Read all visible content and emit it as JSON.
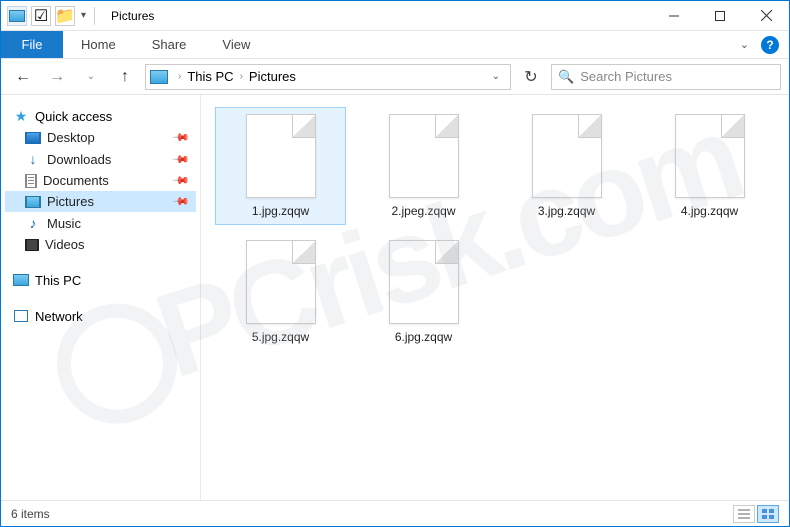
{
  "window": {
    "title": "Pictures"
  },
  "ribbon": {
    "file": "File",
    "tabs": [
      "Home",
      "Share",
      "View"
    ]
  },
  "breadcrumb": {
    "items": [
      "This PC",
      "Pictures"
    ]
  },
  "search": {
    "placeholder": "Search Pictures"
  },
  "sidebar": {
    "quick_access": {
      "label": "Quick access",
      "items": [
        {
          "label": "Desktop",
          "icon": "desktop",
          "pinned": true
        },
        {
          "label": "Downloads",
          "icon": "downloads",
          "pinned": true
        },
        {
          "label": "Documents",
          "icon": "doc",
          "pinned": true
        },
        {
          "label": "Pictures",
          "icon": "pic",
          "pinned": true,
          "selected": true
        },
        {
          "label": "Music",
          "icon": "music",
          "pinned": false
        },
        {
          "label": "Videos",
          "icon": "video",
          "pinned": false
        }
      ]
    },
    "this_pc": {
      "label": "This PC"
    },
    "network": {
      "label": "Network"
    }
  },
  "files": [
    {
      "name": "1.jpg.zqqw"
    },
    {
      "name": "2.jpeg.zqqw"
    },
    {
      "name": "3.jpg.zqqw"
    },
    {
      "name": "4.jpg.zqqw"
    },
    {
      "name": "5.jpg.zqqw"
    },
    {
      "name": "6.jpg.zqqw"
    }
  ],
  "status": {
    "item_count": "6 items"
  },
  "watermark": "PCrisk.com"
}
